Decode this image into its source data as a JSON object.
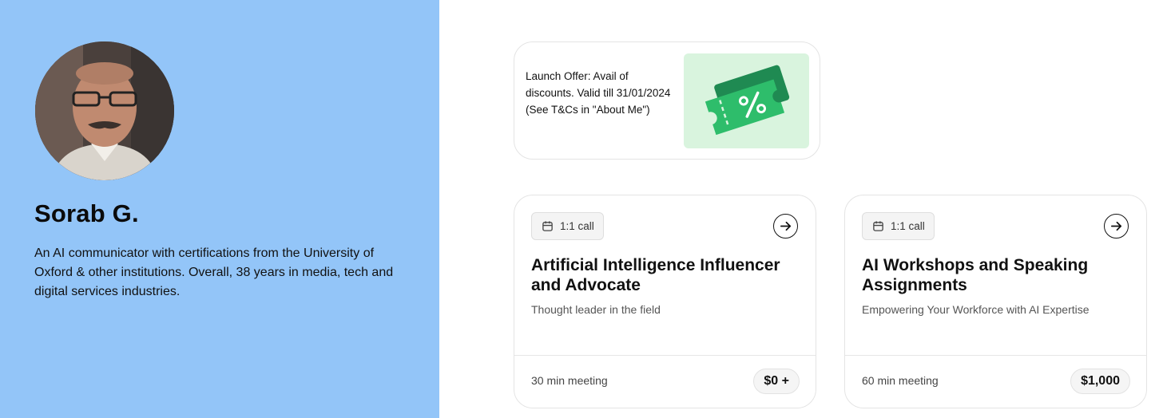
{
  "profile": {
    "name": "Sorab G.",
    "bio": "An AI communicator with certifications from the University of Oxford & other institutions. Overall, 38 years in media, tech and digital services industries."
  },
  "offer": {
    "text": "Launch Offer: Avail of discounts. Valid till 31/01/2024\n(See T&Cs in \"About Me\")",
    "image_icon": "discount-ticket-icon"
  },
  "services": [
    {
      "badge": "1:1 call",
      "title": "Artificial Intelligence Influencer and Advocate",
      "subtitle": "Thought leader in the field",
      "duration": "30 min meeting",
      "price": "$0 +"
    },
    {
      "badge": "1:1 call",
      "title": "AI Workshops and Speaking Assignments",
      "subtitle": "Empowering Your Workforce with AI Expertise",
      "duration": "60 min meeting",
      "price": "$1,000"
    }
  ],
  "colors": {
    "left_panel": "#93c5f8",
    "ticket_green": "#2ebd6b",
    "ticket_dark": "#1f8a52",
    "ticket_bg": "#d9f4de"
  }
}
